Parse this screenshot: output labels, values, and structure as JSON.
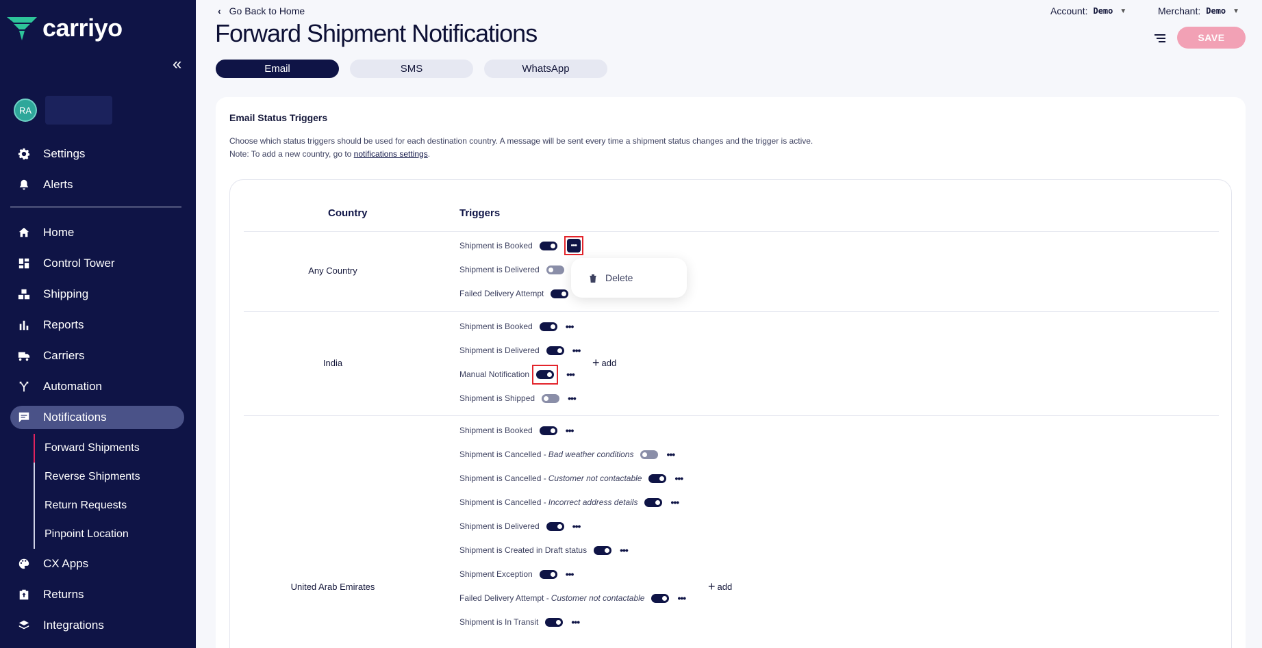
{
  "sidebar": {
    "brand": "carriyo",
    "avatar_initials": "RA",
    "nav_top": [
      {
        "label": "Settings",
        "icon": "gear-icon"
      },
      {
        "label": "Alerts",
        "icon": "bell-icon"
      }
    ],
    "nav_main": [
      {
        "label": "Home",
        "icon": "home-icon"
      },
      {
        "label": "Control Tower",
        "icon": "dashboard-icon"
      },
      {
        "label": "Shipping",
        "icon": "boxes-icon"
      },
      {
        "label": "Reports",
        "icon": "bar-chart-icon"
      },
      {
        "label": "Carriers",
        "icon": "truck-icon"
      },
      {
        "label": "Automation",
        "icon": "automation-icon"
      },
      {
        "label": "Notifications",
        "icon": "message-icon"
      }
    ],
    "subnav": [
      {
        "label": "Forward Shipments"
      },
      {
        "label": "Reverse Shipments"
      },
      {
        "label": "Return Requests"
      },
      {
        "label": "Pinpoint Location"
      }
    ],
    "nav_bottom": [
      {
        "label": "CX Apps",
        "icon": "palette-icon"
      },
      {
        "label": "Returns",
        "icon": "returns-icon"
      },
      {
        "label": "Integrations",
        "icon": "layers-icon"
      }
    ]
  },
  "header": {
    "back_label": "Go Back to Home",
    "title": "Forward Shipment Notifications",
    "account_label": "Account:",
    "account_value": "Demo",
    "merchant_label": "Merchant:",
    "merchant_value": "Demo",
    "save_label": "SAVE"
  },
  "tabs": [
    {
      "label": "Email"
    },
    {
      "label": "SMS"
    },
    {
      "label": "WhatsApp"
    }
  ],
  "card": {
    "title": "Email Status Triggers",
    "desc_line1": "Choose which status triggers should be used for each destination country. A message will be sent every time a shipment status changes and the trigger is active.",
    "desc_line2_prefix": "Note: To add a new country, go to ",
    "desc_link": "notifications settings",
    "desc_line2_suffix": ".",
    "col_country": "Country",
    "col_triggers": "Triggers",
    "add_label": "add"
  },
  "countries": [
    {
      "name": "Any Country",
      "triggers": [
        {
          "label": "Shipment is Booked",
          "reason": "",
          "on": true
        },
        {
          "label": "Shipment is Delivered",
          "reason": "",
          "on": false
        },
        {
          "label": "Failed Delivery Attempt",
          "reason": "",
          "on": true
        }
      ]
    },
    {
      "name": "India",
      "triggers": [
        {
          "label": "Shipment is Booked",
          "reason": "",
          "on": true
        },
        {
          "label": "Shipment is Delivered",
          "reason": "",
          "on": true
        },
        {
          "label": "Manual Notification",
          "reason": "",
          "on": true
        },
        {
          "label": "Shipment is Shipped",
          "reason": "",
          "on": false
        }
      ]
    },
    {
      "name": "United Arab Emirates",
      "triggers": [
        {
          "label": "Shipment is Booked",
          "reason": "",
          "on": true
        },
        {
          "label": "Shipment is Cancelled - ",
          "reason": "Bad weather conditions",
          "on": false
        },
        {
          "label": "Shipment is Cancelled - ",
          "reason": "Customer not contactable",
          "on": true
        },
        {
          "label": "Shipment is Cancelled - ",
          "reason": "Incorrect address details",
          "on": true
        },
        {
          "label": "Shipment is Delivered",
          "reason": "",
          "on": true
        },
        {
          "label": "Shipment is Created in Draft status",
          "reason": "",
          "on": true
        },
        {
          "label": "Shipment Exception",
          "reason": "",
          "on": true
        },
        {
          "label": "Failed Delivery Attempt - ",
          "reason": "Customer not contactable",
          "on": true
        },
        {
          "label": "Shipment is In Transit",
          "reason": "",
          "on": true
        }
      ]
    }
  ],
  "dropdown": {
    "delete_label": "Delete"
  },
  "colors": {
    "sidebar_bg": "#0f1446",
    "accent": "#0f1446",
    "save_disabled": "#f2a1b5",
    "highlight": "#e3242b"
  }
}
